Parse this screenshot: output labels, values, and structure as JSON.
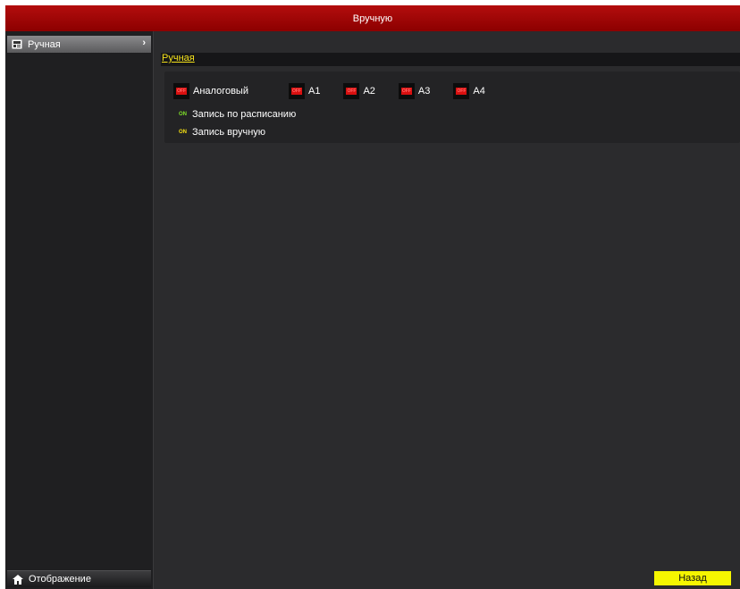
{
  "window": {
    "title": "Вручную"
  },
  "sidebar": {
    "items": [
      {
        "label": "Ручная",
        "icon": "manual-record-icon"
      }
    ],
    "bottom": {
      "label": "Отображение",
      "icon": "home-icon"
    }
  },
  "main": {
    "tabs": [
      {
        "label": "Ручная",
        "active": true
      }
    ],
    "switches": [
      {
        "label": "Аналоговый",
        "state": "OFF"
      },
      {
        "label": "A1",
        "state": "OFF"
      },
      {
        "label": "A2",
        "state": "OFF"
      },
      {
        "label": "A3",
        "state": "OFF"
      },
      {
        "label": "A4",
        "state": "OFF"
      }
    ],
    "legend": [
      {
        "badge": "ON",
        "label": "Запись по расписанию",
        "color": "#7fe02a"
      },
      {
        "badge": "ON",
        "label": "Запись вручную",
        "color": "#f6e012"
      }
    ],
    "back_label": "Назад"
  },
  "colors": {
    "titlebar": "#a30606",
    "accent_yellow": "#f6f600",
    "off_red": "#d81010"
  }
}
